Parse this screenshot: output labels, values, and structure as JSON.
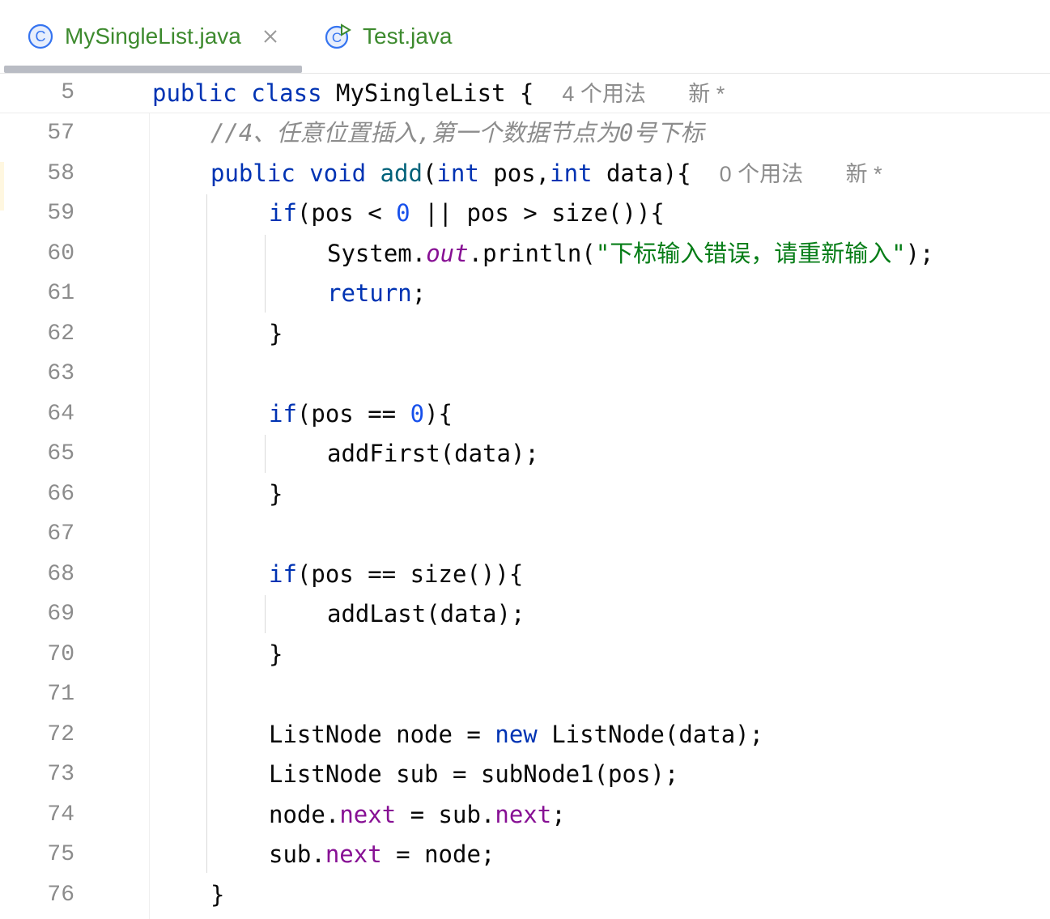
{
  "tabs": [
    {
      "label": "MySingleList.java",
      "active": true
    },
    {
      "label": "Test.java",
      "active": false
    }
  ],
  "sticky": {
    "line_number": "5",
    "kw1": "public",
    "kw2": "class",
    "name": "MySingleList",
    "brace": " {",
    "usages": "4 个用法",
    "new": "新 *"
  },
  "lines": [
    {
      "n": "57",
      "comment": "//4、任意位置插入,第一个数据节点为0号下标"
    },
    {
      "n": "58",
      "kw1": "public",
      "kw2": "void",
      "fn": "add",
      "p1": "(",
      "kw3": "int",
      "p2": " pos,",
      "kw4": "int",
      "p3": " data){",
      "usages": "0 个用法",
      "new": "新 *"
    },
    {
      "n": "59",
      "kw": "if",
      "a": "(pos < ",
      "num": "0",
      "b": " || pos > size()){"
    },
    {
      "n": "60",
      "a": "System.",
      "field": "out",
      "b": ".println(",
      "str": "\"下标输入错误，请重新输入\"",
      "c": ");"
    },
    {
      "n": "61",
      "kw": "return",
      "a": ";"
    },
    {
      "n": "62",
      "a": "}"
    },
    {
      "n": "63"
    },
    {
      "n": "64",
      "kw": "if",
      "a": "(pos == ",
      "num": "0",
      "b": "){"
    },
    {
      "n": "65",
      "a": "addFirst(data);"
    },
    {
      "n": "66",
      "a": "}"
    },
    {
      "n": "67"
    },
    {
      "n": "68",
      "kw": "if",
      "a": "(pos == size()){"
    },
    {
      "n": "69",
      "a": "addLast(data);"
    },
    {
      "n": "70",
      "a": "}"
    },
    {
      "n": "71"
    },
    {
      "n": "72",
      "a": "ListNode node = ",
      "kw": "new",
      "b": " ListNode(data);"
    },
    {
      "n": "73",
      "a": "ListNode sub = subNode1(pos);"
    },
    {
      "n": "74",
      "a": "node.",
      "f1": "next",
      "b": " = sub.",
      "f2": "next",
      "c": ";"
    },
    {
      "n": "75",
      "a": "sub.",
      "f1": "next",
      "b": " = node;"
    },
    {
      "n": "76",
      "a": "}"
    }
  ],
  "colors": {
    "keyword": "#0033b3",
    "number": "#1750eb",
    "string": "#067d17",
    "field": "#871094",
    "comment": "#8c8c8c",
    "tab_text": "#3d8a2e"
  },
  "icons": [
    "class-icon",
    "close-icon",
    "test-class-icon"
  ]
}
